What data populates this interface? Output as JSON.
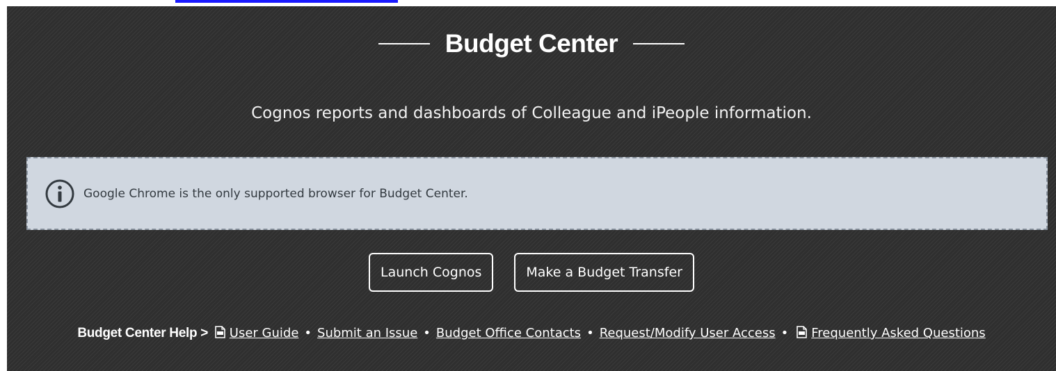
{
  "header": {
    "title": "Budget Center",
    "subtitle": "Cognos reports and dashboards of Colleague and iPeople information."
  },
  "notice": {
    "icon": "info-icon",
    "text": "Google Chrome is the only supported browser for Budget Center."
  },
  "buttons": {
    "launch_cognos": "Launch Cognos",
    "budget_transfer": "Make a Budget Transfer"
  },
  "help": {
    "label": "Budget Center Help >",
    "separator": "•",
    "links": [
      {
        "label": "User Guide",
        "icon": "pdf-icon"
      },
      {
        "label": "Submit an Issue"
      },
      {
        "label": "Budget Office Contacts"
      },
      {
        "label": "Request/Modify User Access"
      },
      {
        "label": "Frequently Asked Questions",
        "icon": "pdf-icon"
      }
    ]
  },
  "colors": {
    "panel_bg": "#2f2f2f",
    "notice_bg": "#d0d7e0",
    "notice_border": "#8c96a2",
    "link_bar": "#1a1aff",
    "text": "#ffffff"
  }
}
